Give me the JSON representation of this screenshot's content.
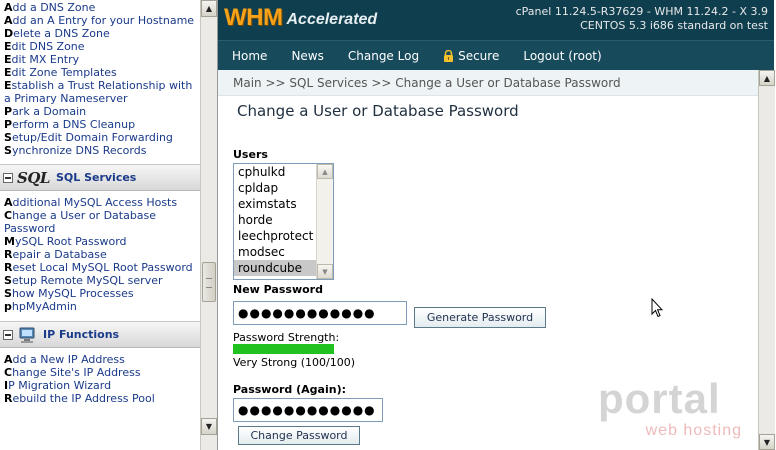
{
  "nav": {
    "dns_links": [
      {
        "first": "A",
        "rest": "dd a DNS Zone"
      },
      {
        "first": "A",
        "rest": "dd an A Entry for your Hostname"
      },
      {
        "first": "D",
        "rest": "elete a DNS Zone"
      },
      {
        "first": "E",
        "rest": "dit DNS Zone"
      },
      {
        "first": "E",
        "rest": "dit MX Entry"
      },
      {
        "first": "E",
        "rest": "dit Zone Templates"
      },
      {
        "first": "E",
        "rest": "stablish a Trust Relationship with a Primary Nameserver"
      },
      {
        "first": "P",
        "rest": "ark a Domain"
      },
      {
        "first": "P",
        "rest": "erform a DNS Cleanup"
      },
      {
        "first": "S",
        "rest": "etup/Edit Domain Forwarding"
      },
      {
        "first": "S",
        "rest": "ynchronize DNS Records"
      }
    ],
    "sql_section": {
      "badge": "SQL",
      "title": "SQL Services"
    },
    "sql_links": [
      {
        "first": "A",
        "rest": "dditional MySQL Access Hosts"
      },
      {
        "first": "C",
        "rest": "hange a User or Database Password"
      },
      {
        "first": "M",
        "rest": "ySQL Root Password"
      },
      {
        "first": "R",
        "rest": "epair a Database"
      },
      {
        "first": "R",
        "rest": "eset Local MySQL Root Password"
      },
      {
        "first": "S",
        "rest": "etup Remote MySQL server"
      },
      {
        "first": "S",
        "rest": "how MySQL Processes"
      },
      {
        "first": "p",
        "rest": "hpMyAdmin"
      }
    ],
    "ip_section": {
      "title": "IP Functions"
    },
    "ip_links": [
      {
        "first": "A",
        "rest": "dd a New IP Address"
      },
      {
        "first": "C",
        "rest": "hange Site's IP Address"
      },
      {
        "first": "I",
        "rest": "P Migration Wizard"
      },
      {
        "first": "R",
        "rest": "ebuild the IP Address Pool"
      }
    ]
  },
  "header": {
    "logo_main": "WHM",
    "logo_sub": "Accelerated",
    "version_line1": "cPanel 11.24.5-R37629 - WHM 11.24.2 - X 3.9",
    "version_line2": "CENTOS 5.3 i686 standard on test"
  },
  "menu": [
    {
      "label": "Home"
    },
    {
      "label": "News"
    },
    {
      "label": "Change Log"
    },
    {
      "label": "Secure",
      "icon": "lock-icon"
    },
    {
      "label": "Logout (root)"
    }
  ],
  "breadcrumb": "Main >> SQL Services >> Change a User or Database Password",
  "page_title": "Change a User or Database Password",
  "form": {
    "users_label": "Users",
    "users": [
      "cphulkd",
      "cpldap",
      "eximstats",
      "horde",
      "leechprotect",
      "modsec",
      "roundcube"
    ],
    "selected_user": "roundcube",
    "new_password_label": "New Password",
    "new_password_value": "●●●●●●●●●●●●",
    "generate_button": "Generate Password",
    "strength_label": "Password Strength:",
    "strength_percent": 100,
    "strength_text": "Very Strong (100/100)",
    "password_again_label": "Password (Again):",
    "password_again_value": "●●●●●●●●●●●●",
    "change_button": "Change Password"
  },
  "watermark": {
    "main": "portal",
    "sub": "web hosting"
  },
  "colors": {
    "header_bg": "#0f3e4f",
    "menu_bg": "#174b5c",
    "logo_orange": "#f6a21a",
    "strength_green": "#1fc21f",
    "nav_link": "#1a3a8a"
  }
}
